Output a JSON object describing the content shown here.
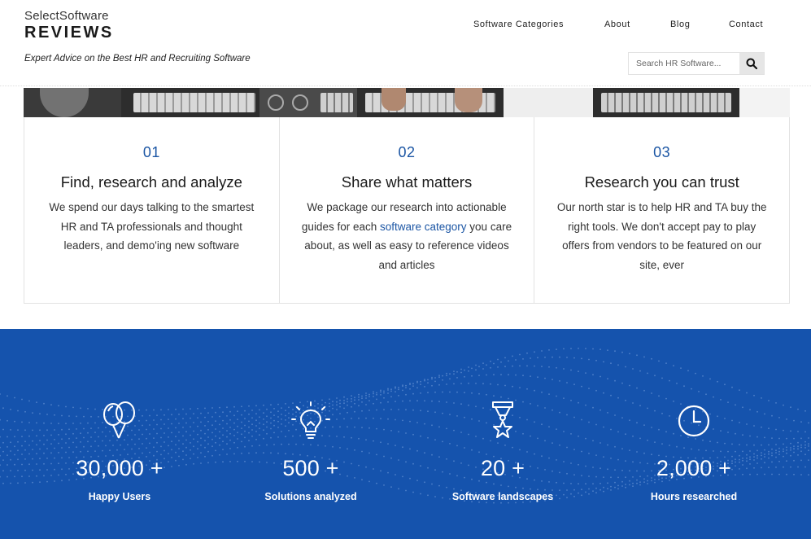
{
  "header": {
    "logo_top": "SelectSoftware",
    "logo_main": "REVIEWS",
    "tagline": "Expert Advice on the Best HR and Recruiting Software",
    "nav": [
      "Software Categories",
      "About",
      "Blog",
      "Contact"
    ],
    "search_placeholder": "Search HR Software...",
    "search_icon": "search-icon"
  },
  "features": [
    {
      "num": "01",
      "title": "Find, research and analyze",
      "desc": "We spend our days talking to the smartest HR and TA professionals and thought leaders, and demo'ing new software"
    },
    {
      "num": "02",
      "title": "Share what matters",
      "desc_before": "We package our research into actionable guides for each ",
      "desc_link": "software category",
      "desc_after": " you care about, as well as easy to reference videos and articles"
    },
    {
      "num": "03",
      "title": "Research you can trust",
      "desc": "Our north star is to help HR and TA buy the right tools. We don't accept pay to play offers from vendors to be featured on our site, ever"
    }
  ],
  "stats": [
    {
      "icon": "balloons-icon",
      "value": "30,000 +",
      "label": "Happy Users"
    },
    {
      "icon": "lightbulb-icon",
      "value": "500 +",
      "label": "Solutions analyzed"
    },
    {
      "icon": "medal-icon",
      "value": "20 +",
      "label": "Software landscapes"
    },
    {
      "icon": "clock-icon",
      "value": "2,000 +",
      "label": "Hours researched"
    }
  ],
  "colors": {
    "accent": "#1c56a4",
    "stats_bg": "#1553ad"
  }
}
